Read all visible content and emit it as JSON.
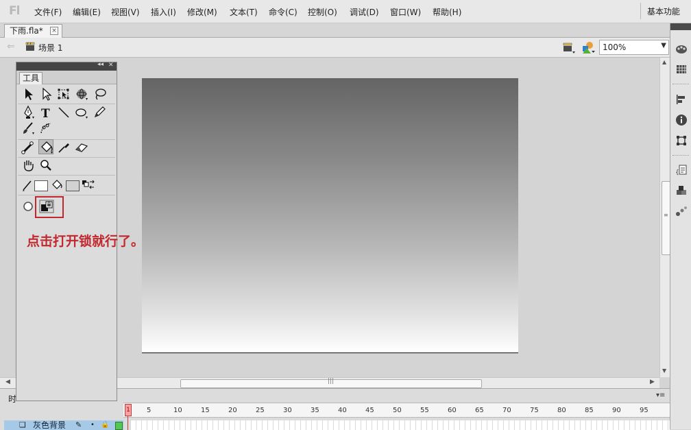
{
  "app": {
    "logo_text": "Fl"
  },
  "menu": {
    "items": [
      "文件(F)",
      "编辑(E)",
      "视图(V)",
      "插入(I)",
      "修改(M)",
      "文本(T)",
      "命令(C)",
      "控制(O)",
      "调试(D)",
      "窗口(W)",
      "帮助(H)"
    ],
    "workspace_label": "基本功能"
  },
  "document": {
    "tab_title": "下雨.fla*",
    "close_glyph": "×"
  },
  "editbar": {
    "scene_label": "场景 1",
    "zoom_value": "100%"
  },
  "stage": {
    "gradient_top": "#646464",
    "gradient_bottom": "#ffffff",
    "accent": "#c1272d"
  },
  "tools_panel": {
    "tab_label": "工具",
    "annotation": "点击打开锁就行了。",
    "tool_icons": [
      "selection-icon",
      "subselection-icon",
      "free-transform-icon",
      "3d-rotation-icon",
      "lasso-icon",
      "pen-icon",
      "text-icon",
      "line-icon",
      "oval-icon",
      "pencil-icon",
      "brush-icon",
      "deco-icon",
      "bone-icon",
      "paint-bucket-icon",
      "eyedropper-icon",
      "eraser-icon",
      "hand-icon",
      "zoom-icon",
      "stroke-color-icon",
      "fill-color-icon",
      "swap-colors-icon",
      "object-drawing-icon",
      "lock-fill-icon"
    ]
  },
  "timeline": {
    "label": "时",
    "frame_numbers": [
      "1",
      "5",
      "10",
      "15",
      "20",
      "25",
      "30",
      "35",
      "40",
      "45",
      "50",
      "55",
      "60",
      "65",
      "70",
      "75",
      "80",
      "85",
      "90",
      "95"
    ],
    "current_frame": "1",
    "layer_name": "灰色背景"
  }
}
